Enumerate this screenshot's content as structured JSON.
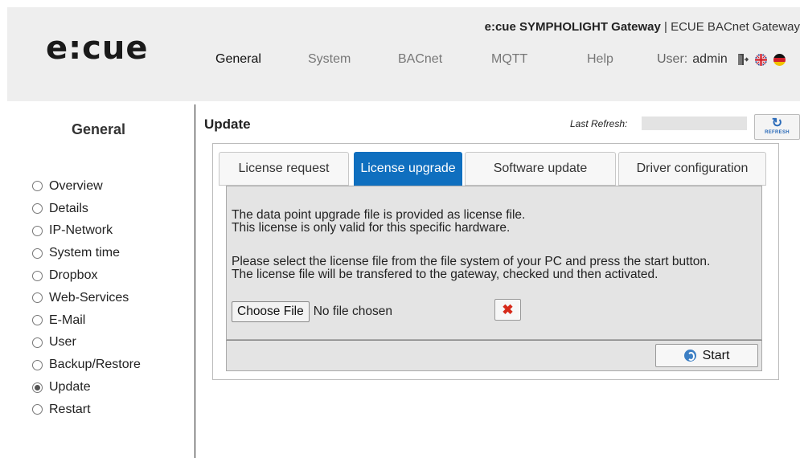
{
  "header": {
    "logo": "e:cue",
    "product_bold": "e:cue SYMPHOLIGHT Gateway",
    "product_rest": " | ECUE BACnet Gateway",
    "nav": [
      "General",
      "System",
      "BACnet",
      "MQTT",
      "Help"
    ],
    "user_label": "User:",
    "user_name": "admin"
  },
  "sidebar": {
    "title": "General",
    "items": [
      "Overview",
      "Details",
      "IP-Network",
      "System time",
      "Dropbox",
      "Web-Services",
      "E-Mail",
      "User",
      "Backup/Restore",
      "Update",
      "Restart"
    ],
    "selected": "Update"
  },
  "main": {
    "title": "Update",
    "last_refresh_label": "Last Refresh:",
    "refresh_button": "REFRESH",
    "tabs": [
      "License request",
      "License upgrade",
      "Software update",
      "Driver configuration"
    ],
    "active_tab": "License upgrade",
    "text_line1": "The data point upgrade file is provided as license file.",
    "text_line2": "This license is only valid for this specific hardware.",
    "text_line3": "Please select the license file from the file system of your PC and press the start button.",
    "text_line4": "The license file will be transfered to the gateway, checked und then activated.",
    "choose_file": "Choose File",
    "no_file": "No file chosen",
    "start": "Start"
  },
  "icons": {
    "logout": "logout-icon",
    "flag_uk": "uk-flag-icon",
    "flag_de": "de-flag-icon",
    "refresh": "refresh-icon",
    "clear": "red-x-icon",
    "start": "sync-icon"
  },
  "colors": {
    "active_tab": "#0f6fbf",
    "header_bg": "#eeeeee",
    "content_bg": "#e4e4e4",
    "clear_icon": "#d62a1a"
  }
}
